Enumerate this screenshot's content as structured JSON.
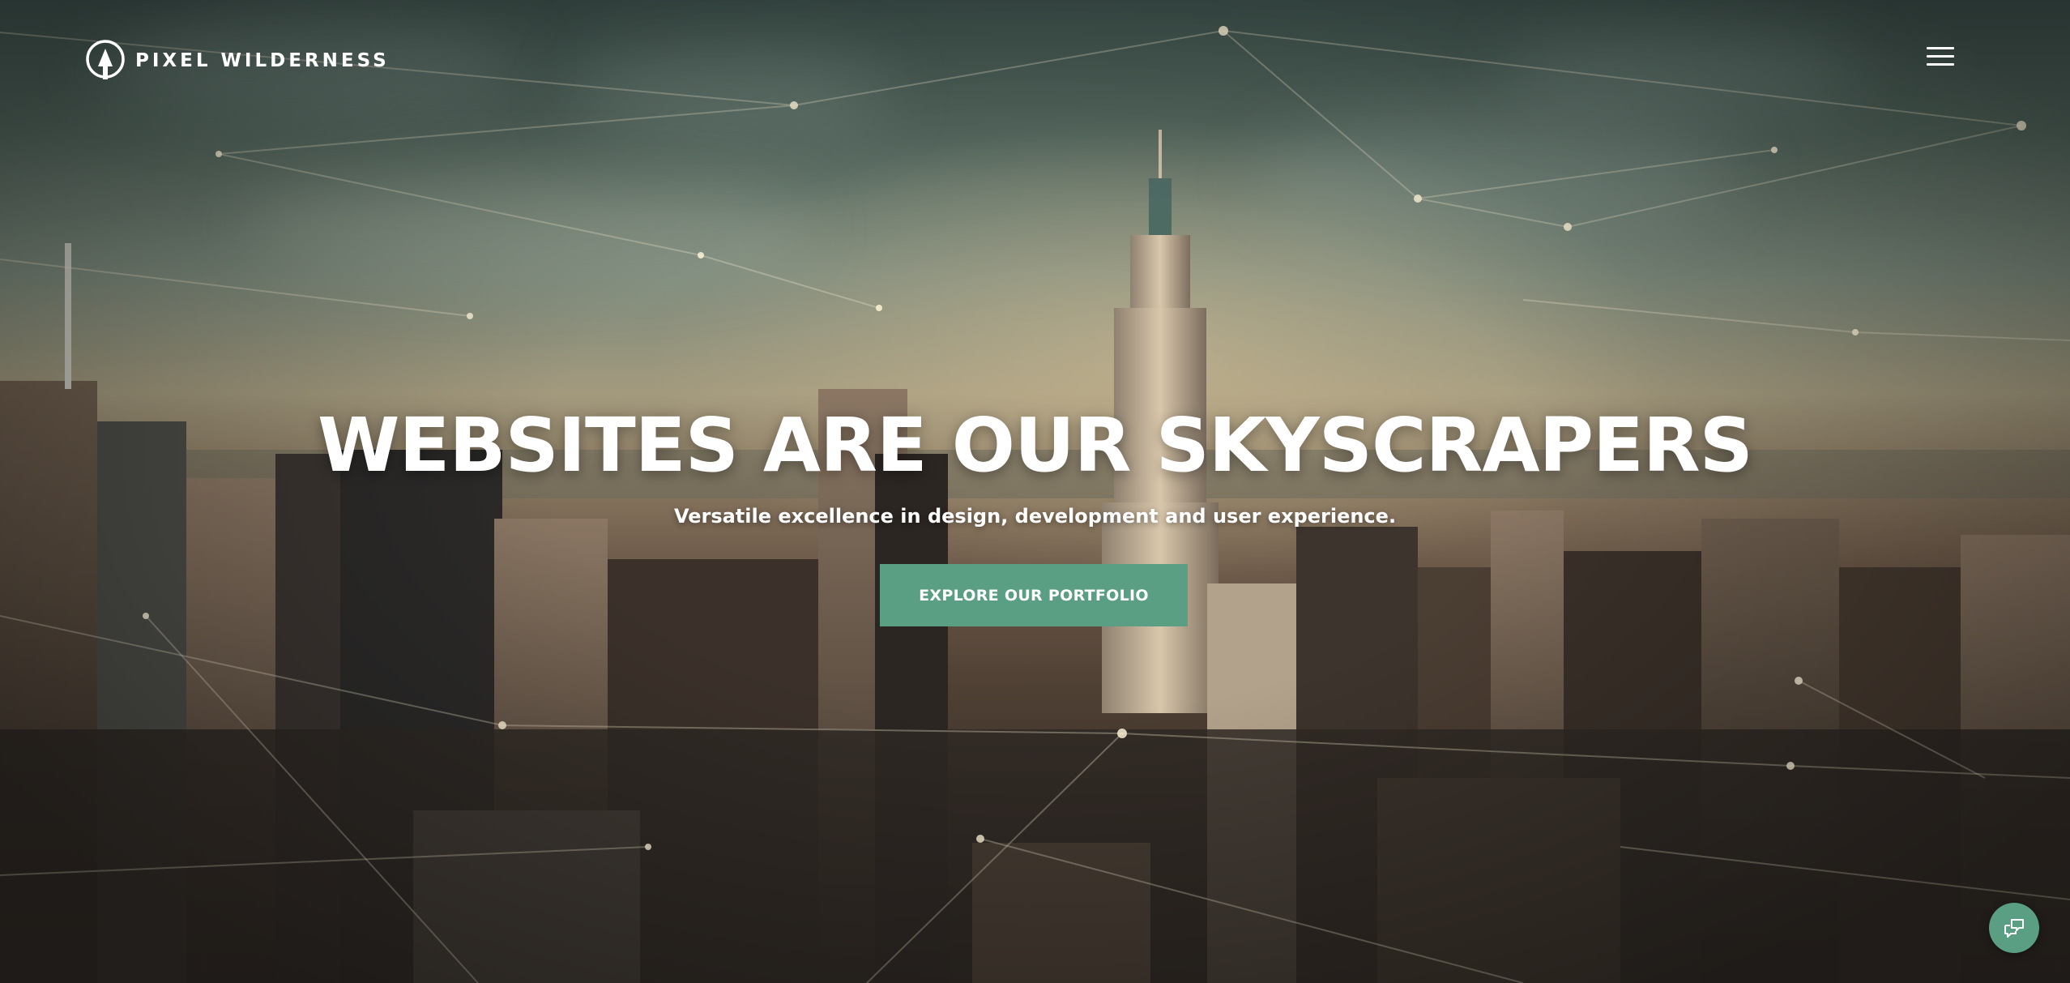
{
  "brand": {
    "name": "PIXEL WILDERNESS",
    "logo_icon": "tree-in-circle-icon"
  },
  "header": {
    "menu_icon": "hamburger-menu-icon"
  },
  "hero": {
    "headline": "WEBSITES ARE OUR SKYSCRAPERS",
    "subtitle": "Versatile excellence in design, development and user experience.",
    "cta_label": "EXPLORE OUR PORTFOLIO",
    "background_image": "city-skyline-with-network-overlay"
  },
  "chat": {
    "icon": "chat-bubbles-icon"
  },
  "colors": {
    "accent": "#5a9e83",
    "text": "#ffffff"
  }
}
